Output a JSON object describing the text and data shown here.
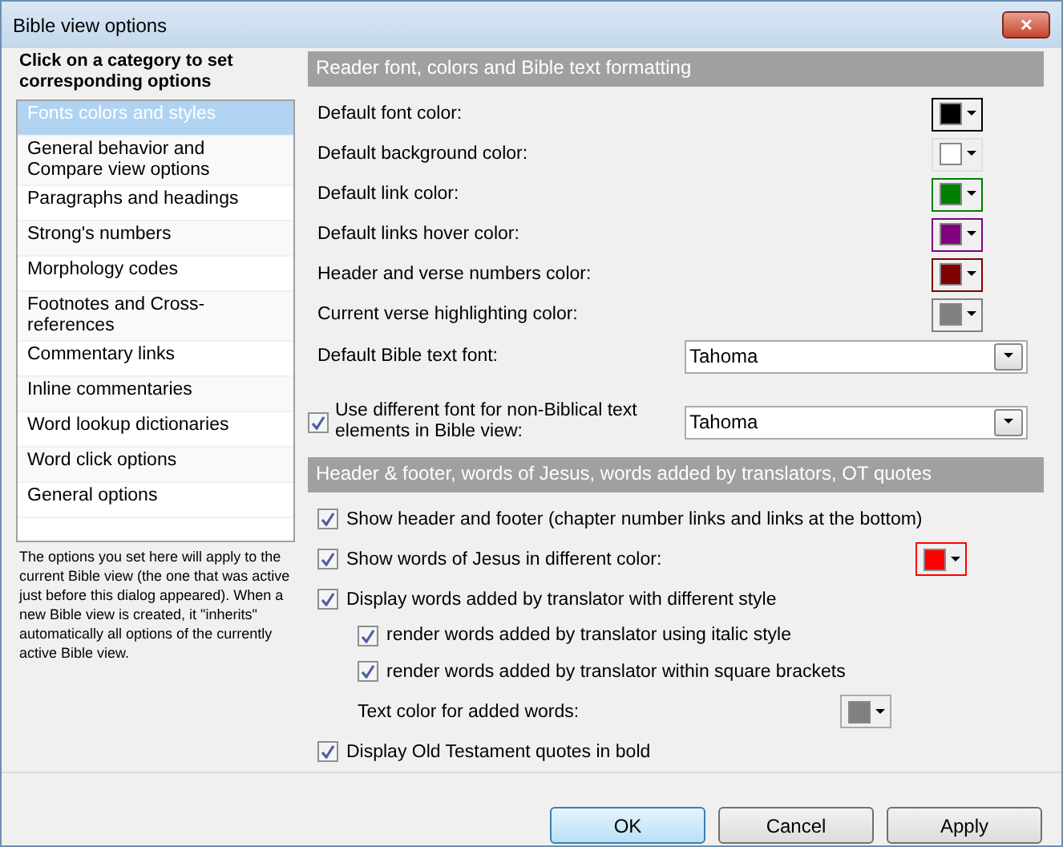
{
  "window": {
    "title": "Bible view options",
    "close": "✕"
  },
  "sidebar": {
    "heading": "Click on a category to set corresponding options",
    "items": [
      {
        "label": "Fonts colors and styles",
        "selected": true
      },
      {
        "label": "General behavior and Compare view options",
        "selected": false
      },
      {
        "label": "Paragraphs and headings",
        "selected": false
      },
      {
        "label": "Strong's numbers",
        "selected": false
      },
      {
        "label": "Morphology codes",
        "selected": false
      },
      {
        "label": "Footnotes and Cross-references",
        "selected": false
      },
      {
        "label": "Commentary links",
        "selected": false
      },
      {
        "label": "Inline commentaries",
        "selected": false
      },
      {
        "label": "Word lookup dictionaries",
        "selected": false
      },
      {
        "label": "Word click options",
        "selected": false
      },
      {
        "label": "General options",
        "selected": false
      }
    ],
    "note": "The options you set here will apply to the current Bible view (the one that was active just before this dialog appeared). When a new Bible view is created, it \"inherits\" automatically all options of the currently active Bible view."
  },
  "section_1": {
    "title": "Reader font, colors and Bible text formatting",
    "colors": [
      {
        "label": "Default font color:",
        "color": "#000000"
      },
      {
        "label": "Default background color:",
        "color": "#ffffff"
      },
      {
        "label": "Default link color:",
        "color": "#008000"
      },
      {
        "label": "Default links hover color:",
        "color": "#800080"
      },
      {
        "label": "Header and verse numbers color:",
        "color": "#800000"
      },
      {
        "label": "Current verse highlighting color:",
        "color": "#808080"
      }
    ],
    "font": {
      "label": "Default Bible text font:",
      "value": "Tahoma"
    },
    "other_font": {
      "label": "Use different font for non-Biblical text elements in Bible view:",
      "checked": true,
      "value": "Tahoma"
    }
  },
  "section_2": {
    "title": "Header & footer, words of Jesus, words added by translators, OT quotes",
    "options": [
      {
        "kind": "check",
        "label": "Show header and footer (chapter number links and links at the bottom)",
        "checked": true,
        "indented": false
      },
      {
        "kind": "check_color",
        "label": "Show words of Jesus in different color:",
        "checked": true,
        "indented": false,
        "color": "#ff0000"
      },
      {
        "kind": "check",
        "label": "Display words added by translator with different style",
        "checked": true,
        "indented": false
      },
      {
        "kind": "check",
        "label": "render words added by translator using italic style",
        "checked": true,
        "indented": true
      },
      {
        "kind": "check",
        "label": "render words added by translator within square brackets",
        "checked": true,
        "indented": true
      },
      {
        "kind": "color",
        "label": "Text color for added words:",
        "indented": true,
        "color": "#808080"
      },
      {
        "kind": "check",
        "label": "Display Old Testament quotes in bold",
        "checked": true,
        "indented": false
      }
    ]
  },
  "buttons": [
    {
      "label": "OK",
      "default": true
    },
    {
      "label": "Cancel",
      "default": false
    },
    {
      "label": "Apply",
      "default": false
    }
  ]
}
